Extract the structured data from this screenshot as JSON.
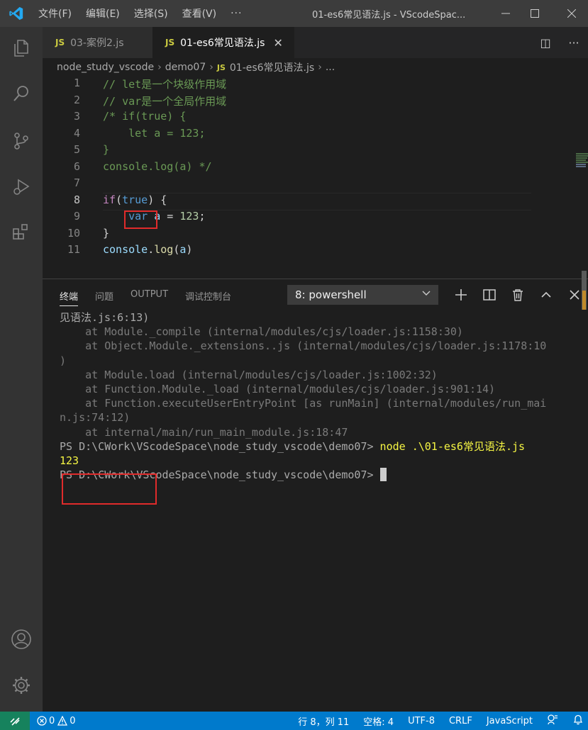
{
  "titlebar": {
    "menu": [
      "文件(F)",
      "编辑(E)",
      "选择(S)",
      "查看(V)"
    ],
    "more": "···",
    "window_title": "01-es6常见语法.js - VScodeSpac..."
  },
  "tabs": [
    {
      "badge": "JS",
      "label": "03-案例2.js"
    },
    {
      "badge": "JS",
      "label": "01-es6常见语法.js",
      "close": "✕"
    }
  ],
  "tab_actions": {
    "split": "◫",
    "more": "···"
  },
  "breadcrumb": {
    "items": [
      "node_study_vscode",
      "demo07"
    ],
    "file_badge": "JS",
    "file": "01-es6常见语法.js",
    "tail": "..."
  },
  "editor": {
    "line_numbers": [
      "1",
      "2",
      "3",
      "4",
      "5",
      "6",
      "7",
      "8",
      "9",
      "10",
      "11"
    ],
    "current_line": 8
  },
  "panel": {
    "tabs": [
      "终端",
      "问题",
      "OUTPUT",
      "调试控制台"
    ],
    "terminal_select": "8: powershell",
    "actions": [
      "+",
      "◫",
      "🗑",
      "^",
      "✕"
    ]
  },
  "terminal": {
    "lines": [
      "见语法.js:6:13)",
      "    at Module._compile (internal/modules/cjs/loader.js:1158:30)",
      "    at Object.Module._extensions..js (internal/modules/cjs/loader.js:1178:10",
      ")",
      "    at Module.load (internal/modules/cjs/loader.js:1002:32)",
      "    at Function.Module._load (internal/modules/cjs/loader.js:901:14)",
      "    at Function.executeUserEntryPoint [as runMain] (internal/modules/run_mai",
      "n.js:74:12)",
      "    at internal/main/run_main_module.js:18:47"
    ],
    "prompt": "PS D:\\CWork\\VScodeSpace\\node_study_vscode\\demo07>",
    "command": "node .\\01-es6常见语法.js",
    "output": "123",
    "prompt2": "PS D:\\CWork\\VScodeSpace\\node_study_vscode\\demo07>"
  },
  "statusbar": {
    "errors": "0",
    "warnings": "0",
    "position": "行 8，列 11",
    "indent": "空格: 4",
    "encoding": "UTF-8",
    "eol": "CRLF",
    "language": "JavaScript"
  },
  "colors": {
    "accent": "#007acc",
    "remote": "#16825d",
    "highlight_box": "#e02b2b"
  }
}
